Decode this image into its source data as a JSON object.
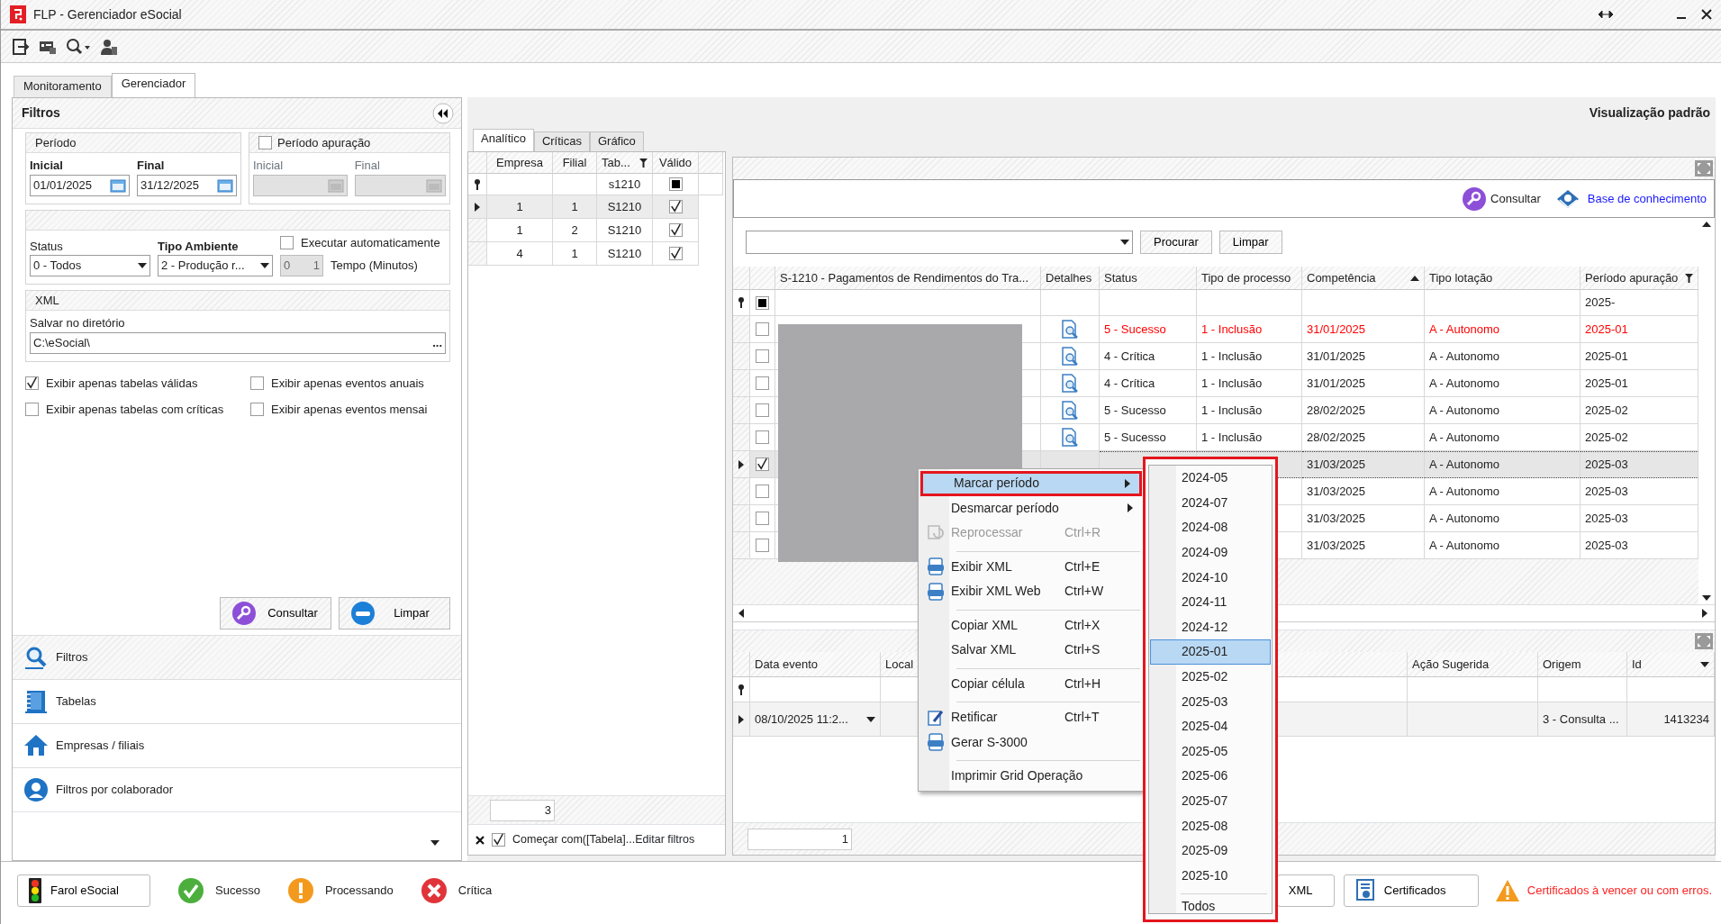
{
  "window": {
    "title": "FLP - Gerenciador eSocial"
  },
  "main_tabs": [
    {
      "label": "Monitoramento",
      "selected": false
    },
    {
      "label": "Gerenciador",
      "selected": true
    }
  ],
  "filters": {
    "title": "Filtros",
    "periodo": {
      "title": "Período",
      "inicial_label": "Inicial",
      "inicial": "01/01/2025",
      "final_label": "Final",
      "final": "31/12/2025"
    },
    "periodo_apuracao": {
      "label": "Período apuração",
      "checked": false,
      "inicial_label": "Inicial",
      "final_label": "Final"
    },
    "status": {
      "label": "Status",
      "value": "0 - Todos"
    },
    "tipo_ambiente": {
      "label": "Tipo Ambiente",
      "value": "2 - Produção r..."
    },
    "executar": {
      "label": "Executar automaticamente",
      "checked": false
    },
    "tempo": {
      "value": "0",
      "spin_value": "1",
      "label": "Tempo (Minutos)",
      "disabled": true
    },
    "xml": {
      "title": "XML",
      "label": "Salvar no diretório",
      "value": "C:\\eSocial\\",
      "browse": "..."
    },
    "options": [
      {
        "label": "Exibir apenas tabelas válidas",
        "checked": true
      },
      {
        "label": "Exibir apenas eventos anuais",
        "checked": false
      },
      {
        "label": "Exibir apenas tabelas com críticas",
        "checked": false
      },
      {
        "label": "Exibir apenas eventos mensai",
        "checked": false
      }
    ],
    "buttons": [
      {
        "label": "Consultar",
        "kind": "search"
      },
      {
        "label": "Limpar",
        "kind": "clear"
      }
    ]
  },
  "nav": [
    {
      "label": "Filtros",
      "kind": "search",
      "selected": true
    },
    {
      "label": "Tabelas",
      "kind": "tables",
      "selected": false
    },
    {
      "label": "Empresas / filiais",
      "kind": "company",
      "selected": false
    },
    {
      "label": "Filtros por colaborador",
      "kind": "person",
      "selected": false
    }
  ],
  "view_title": "Visualização padrão",
  "sub_tabs": [
    {
      "label": "Analítico",
      "selected": true
    },
    {
      "label": "Críticas",
      "selected": false
    },
    {
      "label": "Gráfico",
      "selected": false
    }
  ],
  "tables_grid": {
    "columns": [
      "Empresa",
      "Filial",
      "Tab...",
      "Válido"
    ],
    "filter": {
      "tabela": "s1210",
      "partial": true
    },
    "rows": [
      {
        "empresa": "1",
        "filial": "1",
        "tabela": "S1210",
        "valido": true,
        "selected": true
      },
      {
        "empresa": "1",
        "filial": "2",
        "tabela": "S1210",
        "valido": true,
        "selected": false
      },
      {
        "empresa": "4",
        "filial": "1",
        "tabela": "S1210",
        "valido": true,
        "selected": false
      }
    ],
    "count": "3",
    "filter_bar": {
      "checked": true,
      "text": "Começar com([Tabela]...",
      "edit_link": "Editar filtros"
    }
  },
  "events": {
    "consultar": "Consultar",
    "knowledge_link": "Base de conhecimento",
    "search_buttons": [
      "Procurar",
      "Limpar"
    ],
    "columns": [
      "S-1210 - Pagamentos de Rendimentos do Tra...",
      "Detalhes",
      "Status",
      "Tipo de processo",
      "Competência",
      "Tipo lotação",
      "Período apuração"
    ],
    "filter": {
      "partial": true,
      "periodo": "2025-"
    },
    "rows": [
      {
        "selected": false,
        "checked": false,
        "alert": true,
        "status": "5 - Sucesso",
        "tipo": "1 - Inclusão",
        "competencia": "31/01/2025",
        "lotacao": "A - Autonomo",
        "periodo": "2025-01"
      },
      {
        "selected": false,
        "checked": false,
        "alert": false,
        "status": "4 - Crítica",
        "tipo": "1 - Inclusão",
        "competencia": "31/01/2025",
        "lotacao": "A - Autonomo",
        "periodo": "2025-01"
      },
      {
        "selected": false,
        "checked": false,
        "alert": false,
        "status": "4 - Crítica",
        "tipo": "1 - Inclusão",
        "competencia": "31/01/2025",
        "lotacao": "A - Autonomo",
        "periodo": "2025-01"
      },
      {
        "selected": false,
        "checked": false,
        "alert": false,
        "status": "5 - Sucesso",
        "tipo": "1 - Inclusão",
        "competencia": "28/02/2025",
        "lotacao": "A - Autonomo",
        "periodo": "2025-02"
      },
      {
        "selected": false,
        "checked": false,
        "alert": false,
        "status": "5 - Sucesso",
        "tipo": "1 - Inclusão",
        "competencia": "28/02/2025",
        "lotacao": "A - Autonomo",
        "periodo": "2025-02"
      },
      {
        "selected": true,
        "checked": true,
        "alert": false,
        "competencia": "31/03/2025",
        "lotacao": "A - Autonomo",
        "periodo": "2025-03"
      },
      {
        "selected": false,
        "checked": false,
        "alert": false,
        "competencia": "31/03/2025",
        "lotacao": "A - Autonomo",
        "periodo": "2025-03"
      },
      {
        "selected": false,
        "checked": false,
        "alert": false,
        "competencia": "31/03/2025",
        "lotacao": "A - Autonomo",
        "periodo": "2025-03"
      },
      {
        "selected": false,
        "checked": false,
        "alert": false,
        "competencia": "31/03/2025",
        "lotacao": "A - Autonomo",
        "periodo": "2025-03"
      }
    ]
  },
  "log": {
    "columns": [
      "Data evento",
      "Local",
      "Ação Sugerida",
      "Origem",
      "Id"
    ],
    "rows": [
      {
        "data": "08/10/2025 11:2...",
        "origem": "3 - Consulta ...",
        "id": "1413234"
      }
    ],
    "count": "1"
  },
  "context_menu": {
    "items": [
      {
        "kind": "submenu",
        "label": "Marcar período",
        "selected": true,
        "disabled": false,
        "highlighted": true
      },
      {
        "kind": "submenu",
        "label": "Desmarcar período",
        "selected": false,
        "disabled": false,
        "highlighted": false
      },
      {
        "kind": "item",
        "label": "Reprocessar",
        "shortcut": "Ctrl+R",
        "selected": false,
        "disabled": true,
        "highlighted": false
      },
      {
        "kind": "separator"
      },
      {
        "kind": "item",
        "label": "Exibir XML",
        "shortcut": "Ctrl+E",
        "selected": false,
        "disabled": false,
        "highlighted": false
      },
      {
        "kind": "item",
        "label": "Exibir XML Web",
        "shortcut": "Ctrl+W",
        "selected": false,
        "disabled": false,
        "highlighted": false
      },
      {
        "kind": "separator"
      },
      {
        "kind": "item",
        "label": "Copiar XML",
        "shortcut": "Ctrl+X",
        "selected": false,
        "disabled": false,
        "highlighted": false
      },
      {
        "kind": "item",
        "label": "Salvar XML",
        "shortcut": "Ctrl+S",
        "selected": false,
        "disabled": false,
        "highlighted": false
      },
      {
        "kind": "separator"
      },
      {
        "kind": "item",
        "label": "Copiar célula",
        "shortcut": "Ctrl+H",
        "selected": false,
        "disabled": false,
        "highlighted": false
      },
      {
        "kind": "separator"
      },
      {
        "kind": "item",
        "label": "Retificar",
        "shortcut": "Ctrl+T",
        "selected": false,
        "disabled": false,
        "highlighted": false
      },
      {
        "kind": "item",
        "label": "Gerar S-3000",
        "selected": false,
        "disabled": false,
        "highlighted": false
      },
      {
        "kind": "separator"
      },
      {
        "kind": "item",
        "label": "Imprimir Grid Operação",
        "selected": false,
        "disabled": false,
        "highlighted": false
      }
    ]
  },
  "submenu": {
    "highlighted": true,
    "items": [
      {
        "kind": "item",
        "label": "2024-05",
        "selected": false
      },
      {
        "kind": "item",
        "label": "2024-07",
        "selected": false
      },
      {
        "kind": "item",
        "label": "2024-08",
        "selected": false
      },
      {
        "kind": "item",
        "label": "2024-09",
        "selected": false
      },
      {
        "kind": "item",
        "label": "2024-10",
        "selected": false
      },
      {
        "kind": "item",
        "label": "2024-11",
        "selected": false
      },
      {
        "kind": "item",
        "label": "2024-12",
        "selected": false
      },
      {
        "kind": "item",
        "label": "2025-01",
        "selected": true
      },
      {
        "kind": "item",
        "label": "2025-02",
        "selected": false
      },
      {
        "kind": "item",
        "label": "2025-03",
        "selected": false
      },
      {
        "kind": "item",
        "label": "2025-04",
        "selected": false
      },
      {
        "kind": "item",
        "label": "2025-05",
        "selected": false
      },
      {
        "kind": "item",
        "label": "2025-06",
        "selected": false
      },
      {
        "kind": "item",
        "label": "2025-07",
        "selected": false
      },
      {
        "kind": "item",
        "label": "2025-08",
        "selected": false
      },
      {
        "kind": "item",
        "label": "2025-09",
        "selected": false
      },
      {
        "kind": "item",
        "label": "2025-10",
        "selected": false
      },
      {
        "kind": "separator"
      },
      {
        "kind": "item",
        "label": "Todos",
        "selected": false
      }
    ]
  },
  "status_bar": {
    "left": [
      {
        "kind": "farol",
        "label": "Farol eSocial"
      },
      {
        "kind": "success",
        "label": "Sucesso"
      },
      {
        "kind": "processing",
        "label": "Processando"
      },
      {
        "kind": "critical",
        "label": "Crítica"
      }
    ],
    "right": [
      {
        "kind": "button",
        "label": "XML"
      },
      {
        "kind": "certificates",
        "label": "Certificados"
      },
      {
        "kind": "warning",
        "label": "Certificados à vencer ou com erros."
      }
    ]
  }
}
